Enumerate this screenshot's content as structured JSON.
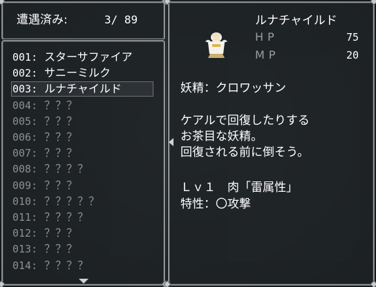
{
  "encounter": {
    "label": "遭遇済み:",
    "value": "3/ 89"
  },
  "enemy_list": [
    {
      "num": "001:",
      "name": "スターサファイア",
      "known": true
    },
    {
      "num": "002:",
      "name": "サニーミルク",
      "known": true
    },
    {
      "num": "003:",
      "name": "ルナチャイルド",
      "known": true,
      "selected": true
    },
    {
      "num": "004:",
      "name": "？？？",
      "known": false
    },
    {
      "num": "005:",
      "name": "？？？",
      "known": false
    },
    {
      "num": "006:",
      "name": "？？？",
      "known": false
    },
    {
      "num": "007:",
      "name": "？？？",
      "known": false
    },
    {
      "num": "008:",
      "name": "？？？？",
      "known": false
    },
    {
      "num": "009:",
      "name": "？？？",
      "known": false
    },
    {
      "num": "010:",
      "name": "？？？？？",
      "known": false
    },
    {
      "num": "011:",
      "name": "？？？？",
      "known": false
    },
    {
      "num": "012:",
      "name": "？？？",
      "known": false
    },
    {
      "num": "013:",
      "name": "？？？",
      "known": false
    },
    {
      "num": "014:",
      "name": "？？？？",
      "known": false
    }
  ],
  "detail": {
    "name": "ルナチャイルド",
    "hp_label": "HP",
    "hp_value": "75",
    "mp_label": "MP",
    "mp_value": "20",
    "race": "妖精：クロワッサン",
    "desc_line1": "ケアルで回復したりする",
    "desc_line2": "お茶目な妖精。",
    "desc_line3": "回復される前に倒そう。",
    "drop": "Ｌｖ１　肉「雷属性」",
    "trait": "特性：〇攻撃"
  },
  "colors": {
    "known_text": "#ffffff",
    "unknown_text": "#8c9090",
    "frame": "#8e9295"
  }
}
